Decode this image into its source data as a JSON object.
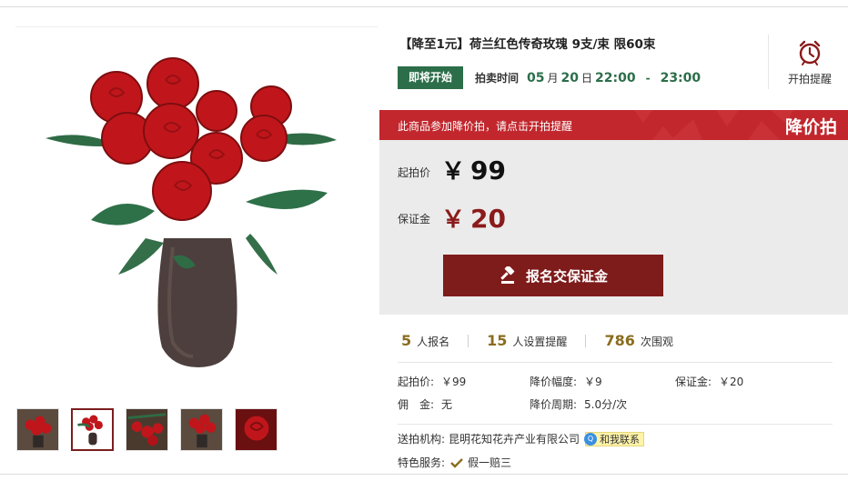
{
  "gallery": {
    "main_image": "red-roses-in-glass-vase",
    "thumbnails": [
      {
        "name": "roses-vase-thumb-1",
        "selected": false
      },
      {
        "name": "roses-vase-thumb-2",
        "selected": true
      },
      {
        "name": "roses-bunch-thumb-3",
        "selected": false
      },
      {
        "name": "roses-vase-thumb-4",
        "selected": false
      },
      {
        "name": "rose-closeup-thumb-5",
        "selected": false
      }
    ]
  },
  "product": {
    "title": "【降至1元】荷兰红色传奇玫瑰 9支/束 限60束"
  },
  "auction": {
    "status": "即将开始",
    "time_label": "拍卖时间",
    "month": "05",
    "month_unit": "月",
    "day": "20",
    "day_unit": "日",
    "start_time": "22:00",
    "dash": "-",
    "end_time": "23:00",
    "remind_label": "开拍提醒",
    "remind_icon": "alarm-clock-icon"
  },
  "banner": {
    "note": "此商品参加降价拍，请点击开拍提醒",
    "tag": "降价拍"
  },
  "prices": {
    "start_label": "起拍价",
    "start_currency": "￥",
    "start_amount": "99",
    "deposit_label": "保证金",
    "deposit_currency": "￥",
    "deposit_amount": "20",
    "cta_label": "报名交保证金",
    "cta_icon": "gavel-icon"
  },
  "stats": [
    {
      "num": "5",
      "label": "人报名"
    },
    {
      "num": "15",
      "label": "人设置提醒"
    },
    {
      "num": "786",
      "label": "次围观"
    }
  ],
  "details": {
    "start_price_key": "起拍价:",
    "start_price_val": "￥99",
    "drop_amount_key": "降价幅度:",
    "drop_amount_val": "￥9",
    "deposit_key": "保证金:",
    "deposit_val": "￥20",
    "commission_key": "佣　金:",
    "commission_val": "无",
    "drop_period_key": "降价周期:",
    "drop_period_val": "5.0分/次"
  },
  "org": {
    "label": "送拍机构:",
    "name": "昆明花知花卉产业有限公司",
    "contact_label": "和我联系",
    "contact_icon": "qq-chat-icon"
  },
  "service": {
    "label": "特色服务:",
    "value": "假一赔三",
    "icon": "check-icon"
  },
  "colors": {
    "green": "#2c6e49",
    "red_banner": "#c1272d",
    "dark_red": "#7e1b1b",
    "gold": "#8a6d1e",
    "panel_gray": "#ebebeb"
  }
}
